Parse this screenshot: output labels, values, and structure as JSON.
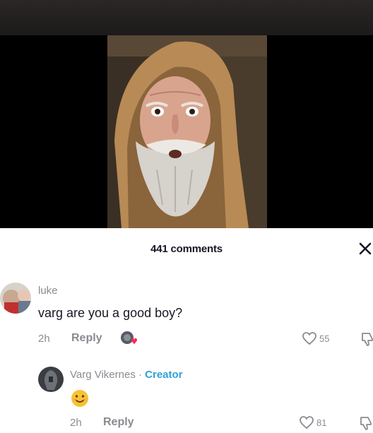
{
  "video": {
    "description_icon": "video-frame"
  },
  "comments": {
    "count_label": "441 comments"
  },
  "thread": [
    {
      "username": "luke",
      "text": "varg are you a good boy?",
      "time": "2h",
      "reply_label": "Reply",
      "likes": "55"
    },
    {
      "username": "Varg Vikernes",
      "separator": "·",
      "creator_badge": "Creator",
      "text_emoji": "😊",
      "time": "2h",
      "reply_label": "Reply",
      "likes": "81"
    }
  ],
  "colors": {
    "creator_accent": "#2ea1d8",
    "text_primary": "#161823",
    "text_secondary": "#8a8b91",
    "liked_heart": "#fe2c55"
  }
}
